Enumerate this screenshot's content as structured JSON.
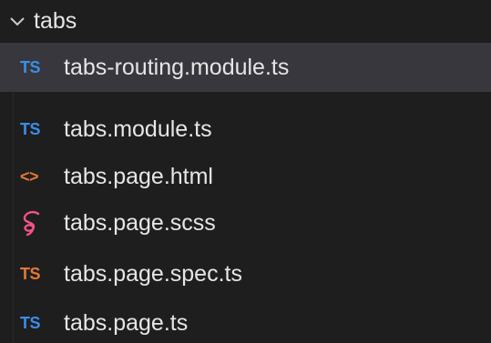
{
  "folder": {
    "name": "tabs",
    "icon": "chevron-down-icon"
  },
  "files": [
    {
      "name": "tabs-routing.module.ts",
      "icon_text": "TS",
      "icon": "typescript-icon",
      "color": "#3b8eea",
      "selected": true
    },
    {
      "name": "tabs.module.ts",
      "icon_text": "TS",
      "icon": "typescript-icon",
      "color": "#3b8eea",
      "selected": false
    },
    {
      "name": "tabs.page.html",
      "icon_text": "<>",
      "icon": "html-icon",
      "color": "#e37933",
      "selected": false
    },
    {
      "name": "tabs.page.scss",
      "icon_text": "",
      "icon": "sass-icon",
      "color": "#f55385",
      "selected": false
    },
    {
      "name": "tabs.page.spec.ts",
      "icon_text": "TS",
      "icon": "typescript-test-icon",
      "color": "#e37933",
      "selected": false
    },
    {
      "name": "tabs.page.ts",
      "icon_text": "TS",
      "icon": "typescript-icon",
      "color": "#3b8eea",
      "selected": false
    }
  ]
}
